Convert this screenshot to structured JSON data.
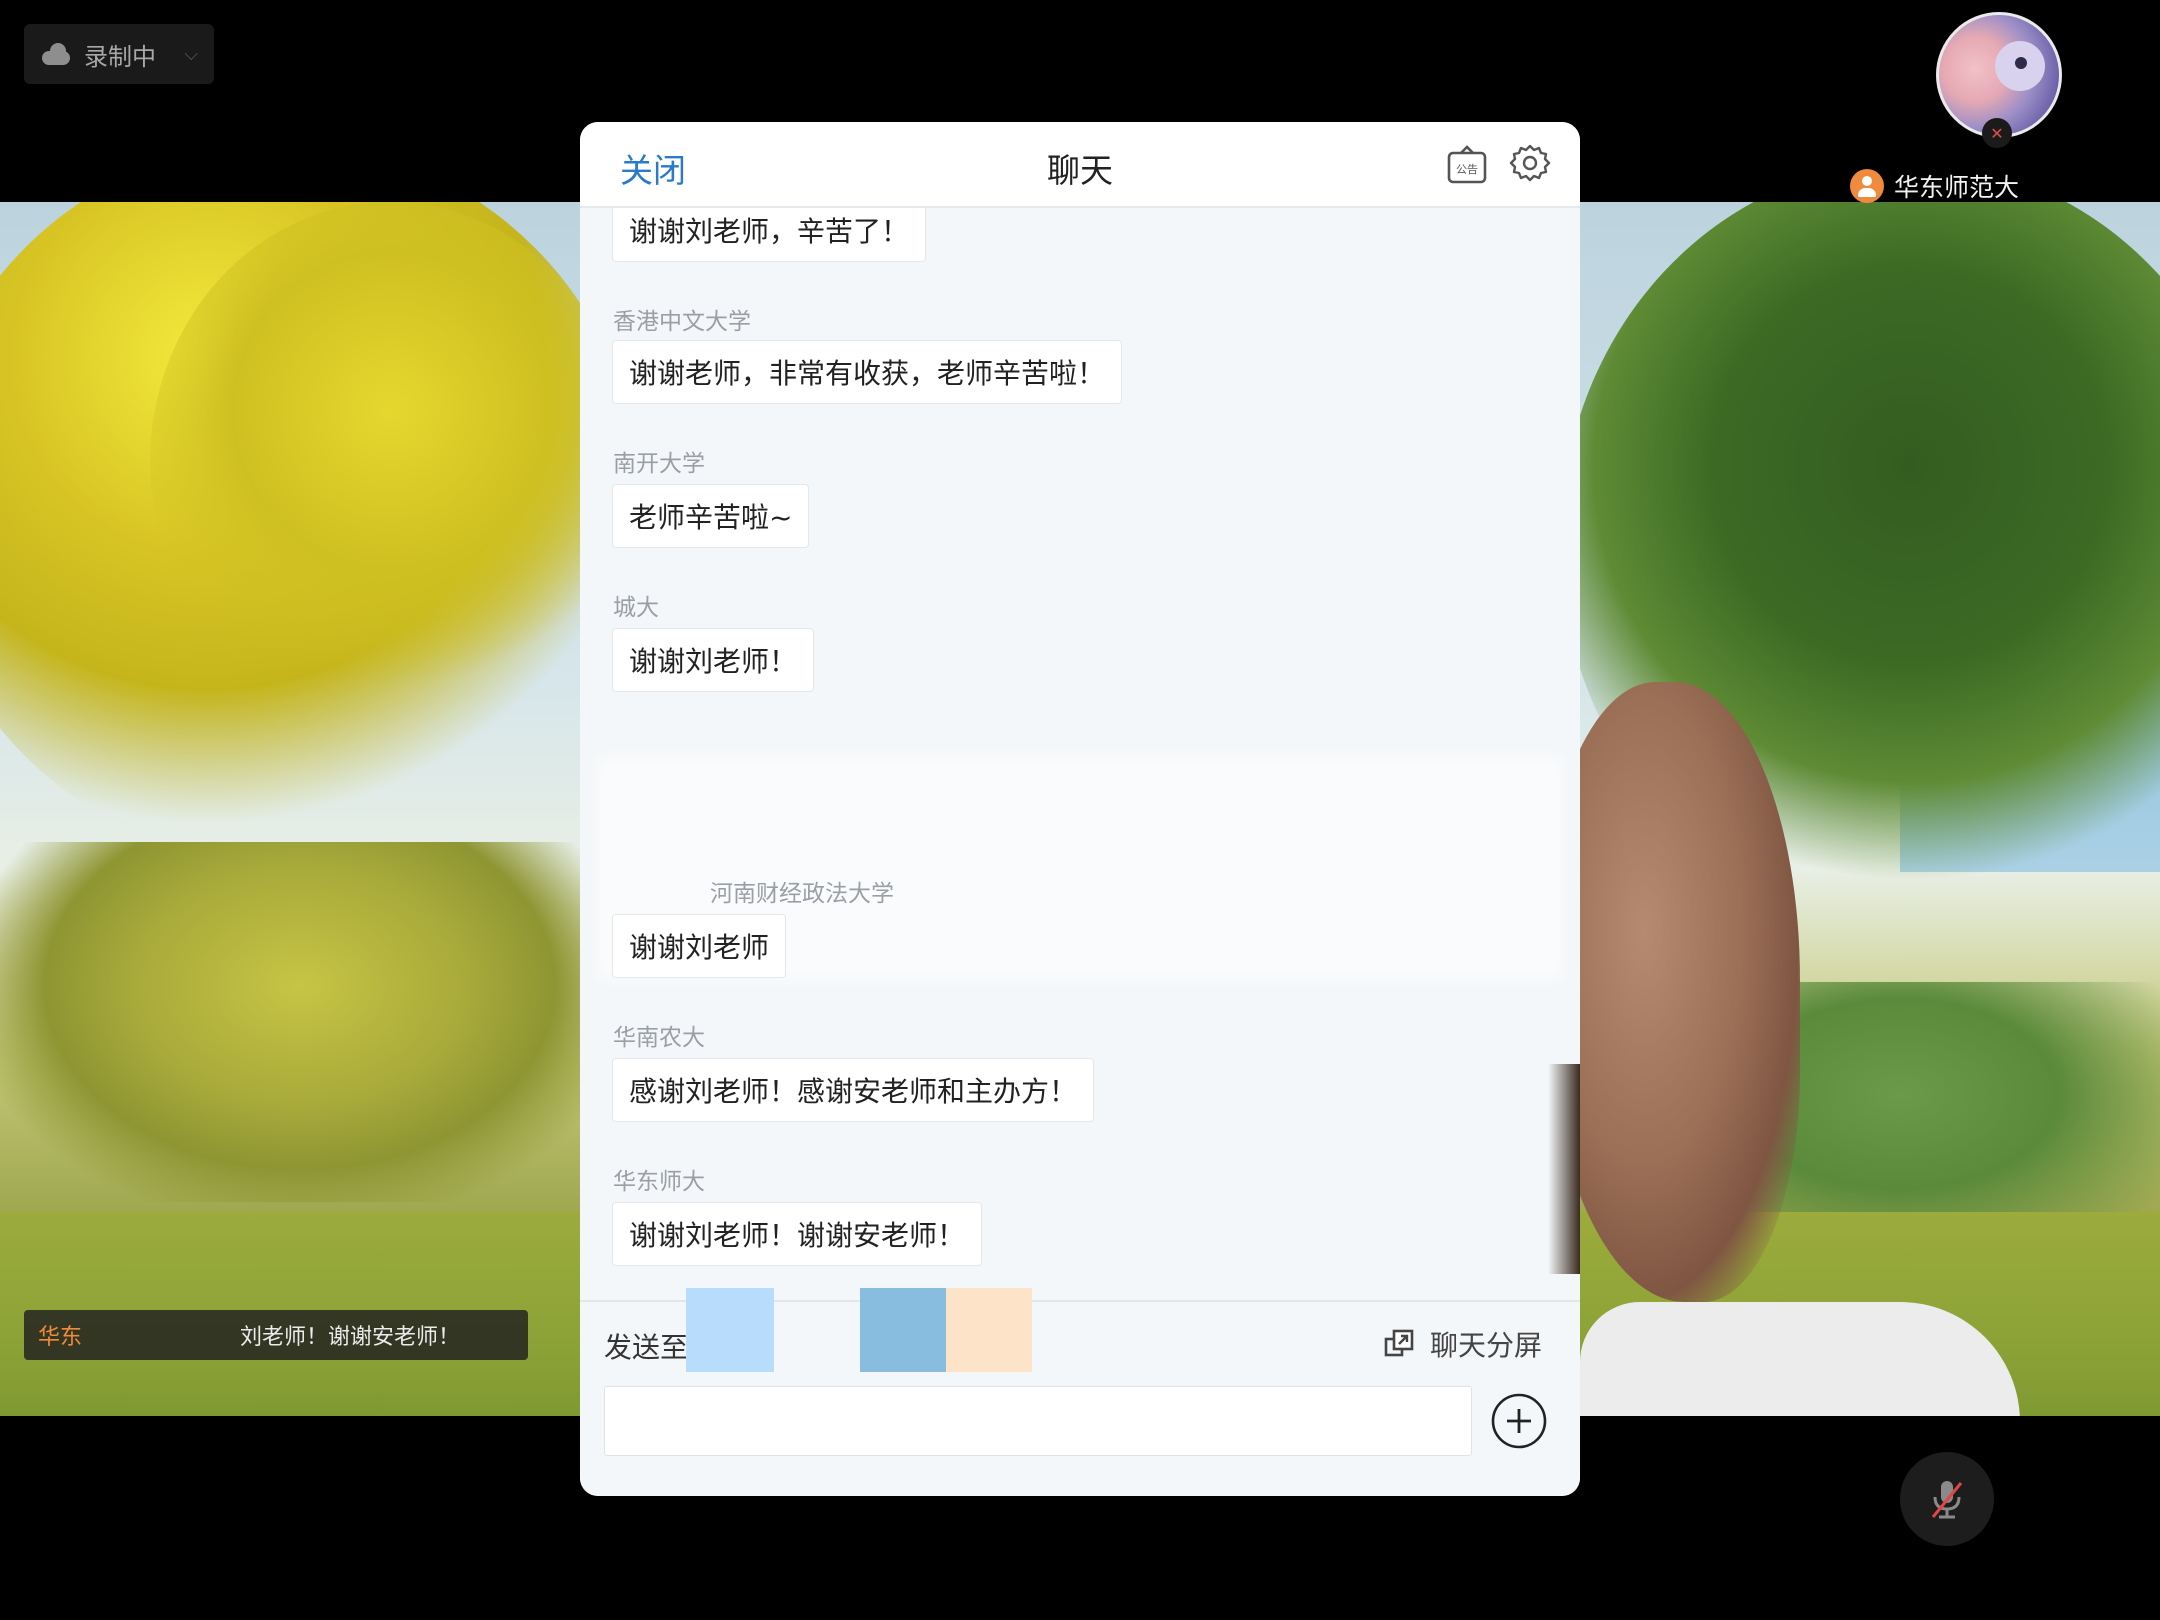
{
  "recording": {
    "label": "录制中"
  },
  "presenter": {
    "name": "华东师范大"
  },
  "caption": {
    "sender": "华东",
    "text": "刘老师！谢谢安老师！"
  },
  "chat": {
    "close_label": "关闭",
    "title": "聊天",
    "notice_icon_text": "公告",
    "messages": [
      {
        "sender": "",
        "text": "谢谢刘老师，辛苦了！"
      },
      {
        "sender": "香港中文大学",
        "text": "谢谢老师，非常有收获，老师辛苦啦！"
      },
      {
        "sender": "南开大学",
        "text": "老师辛苦啦~"
      },
      {
        "sender": "城大",
        "text": "谢谢刘老师！"
      },
      {
        "sender": "河南财经政法大学",
        "text": "谢谢刘老师"
      },
      {
        "sender": "华南农大",
        "text": "感谢刘老师！感谢安老师和主办方！"
      },
      {
        "sender": "华东师大",
        "text": "谢谢刘老师！谢谢安老师！"
      }
    ],
    "footer": {
      "send_to_label": "发送至",
      "split_label": "聊天分屏",
      "input_value": ""
    }
  },
  "colors": {
    "accent": "#2a7ac8",
    "caption_name": "#f08a3c",
    "modal_bg": "#f4f7f9",
    "chip_light_blue": "#b8dcfb",
    "chip_blue": "#89bde0",
    "chip_peach": "#fde3c8"
  },
  "icons": {
    "recording": "cloud-icon",
    "notice": "notice-board-icon",
    "settings": "gear-icon",
    "split": "split-screen-icon",
    "add": "plus-circle-icon",
    "mic": "mic-muted-icon",
    "presenter": "person-icon"
  }
}
